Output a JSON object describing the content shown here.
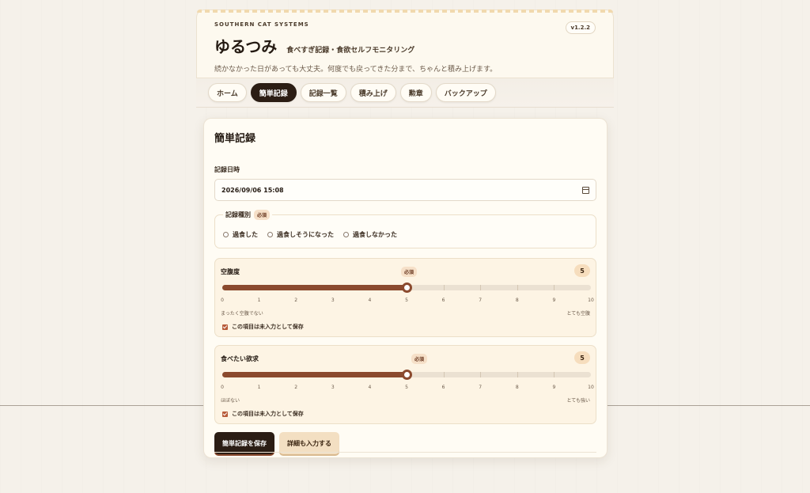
{
  "header": {
    "company": "SOUTHERN CAT SYSTEMS",
    "app_name": "ゆるつみ",
    "tagline": "食べすぎ記録・食欲セルフモニタリング",
    "description": "続かなかった日があっても大丈夫。何度でも戻ってきた分まで、ちゃんと積み上げます。",
    "version": "v1.2.2"
  },
  "nav": {
    "tabs": [
      {
        "label": "ホーム",
        "active": false
      },
      {
        "label": "簡単記録",
        "active": true
      },
      {
        "label": "記録一覧",
        "active": false
      },
      {
        "label": "積み上げ",
        "active": false
      },
      {
        "label": "勲章",
        "active": false
      },
      {
        "label": "バックアップ",
        "active": false
      }
    ]
  },
  "form": {
    "title": "簡単記録",
    "datetime_label": "記録日時",
    "datetime_value": "2026/09/06 15:08",
    "type_label": "記録種別",
    "required": "必須",
    "type_options": [
      "過食した",
      "過食しそうになった",
      "過食しなかった"
    ],
    "sliders": [
      {
        "title": "空腹度",
        "value": 5,
        "min": 0,
        "max": 10,
        "min_label": "まったく空腹でない",
        "max_label": "とても空腹",
        "unset_label": "この項目は未入力として保存",
        "unset_checked": true
      },
      {
        "title": "食べたい欲求",
        "value": 5,
        "min": 0,
        "max": 10,
        "min_label": "ほぼない",
        "max_label": "とても強い",
        "unset_label": "この項目は未入力として保存",
        "unset_checked": true
      }
    ],
    "save_button": "簡単記録を保存",
    "detail_button": "詳細も入力する"
  },
  "colors": {
    "accent": "#8b4a2e",
    "dark": "#2b1d14",
    "badge": "#f6ddbd"
  }
}
